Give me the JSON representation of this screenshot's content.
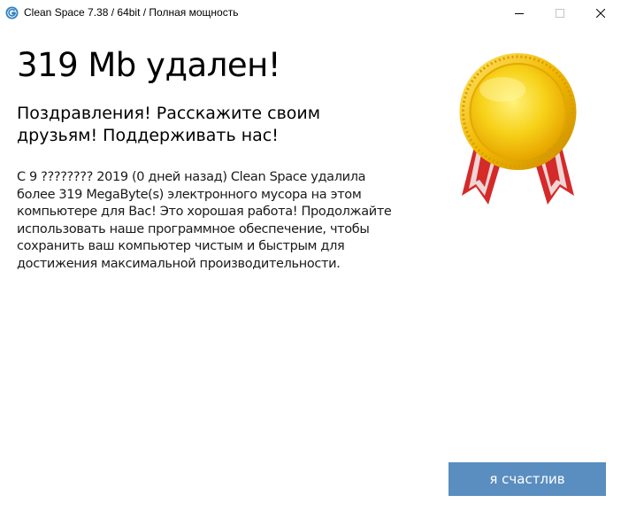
{
  "window": {
    "title": "Clean Space 7.38 / 64bit / Полная мощность",
    "app_icon": "clean-space-logo",
    "controls": {
      "minimize": "minimize-icon",
      "maximize": "maximize-icon",
      "close": "close-icon"
    }
  },
  "main": {
    "headline": "319 Mb удален!",
    "subheadline": "Поздравления! Расскажите своим друзьям! Поддерживать нас!",
    "body": "С 9 ???????? 2019 (0 дней назад) Clean Space удалила более 319 MegaByte(s) электронного мусора на этом компьютере для Вас! Это хорошая работа! Продолжайте использовать наше программное обеспечение, чтобы сохранить ваш компьютер чистым и быстрым для достижения максимальной производительности.",
    "medal_icon": "gold-medal-icon",
    "happy_button": "я счастлив"
  },
  "colors": {
    "button_bg": "#5b8ec0",
    "button_text": "#ffffff",
    "medal_gold": "#f2c200",
    "ribbon_red": "#d92b2b"
  }
}
